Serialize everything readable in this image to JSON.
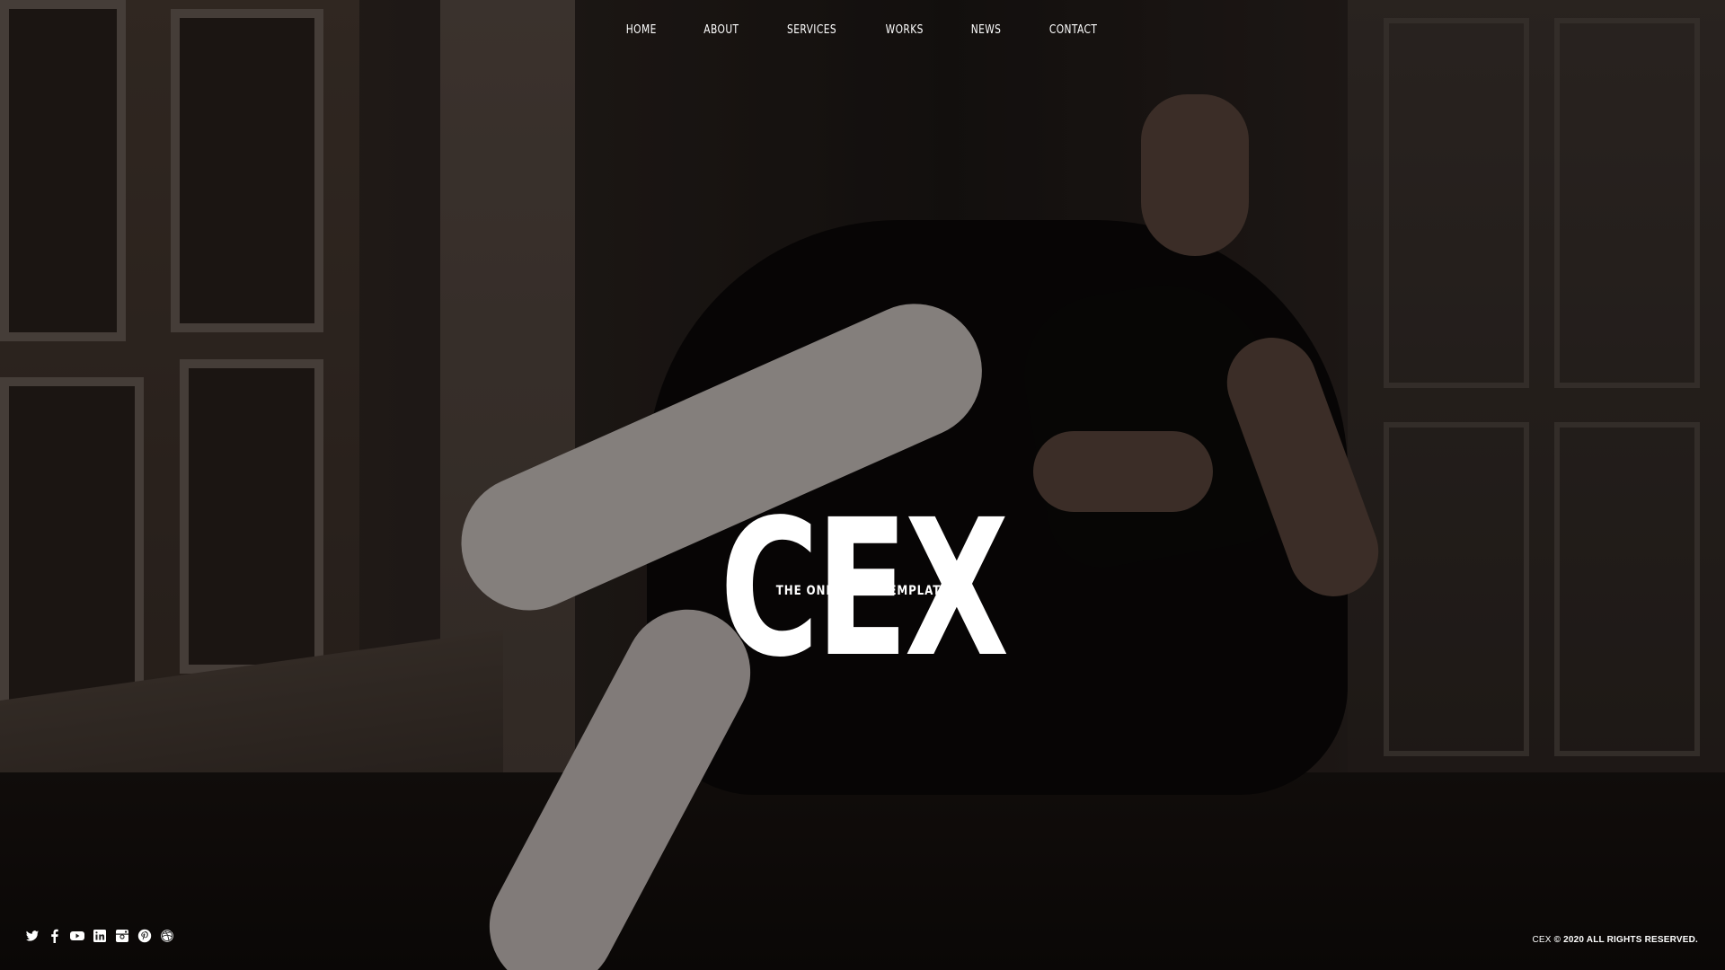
{
  "nav": {
    "items": [
      {
        "label": "HOME"
      },
      {
        "label": "ABOUT"
      },
      {
        "label": "SERVICES"
      },
      {
        "label": "WORKS"
      },
      {
        "label": "NEWS"
      },
      {
        "label": "CONTACT"
      }
    ]
  },
  "hero": {
    "title": "CEX",
    "subtitle": "THE ONE100TH TEMPLATE",
    "background_image": "woman-in-chair-photo"
  },
  "social": {
    "icons": [
      "twitter-icon",
      "facebook-icon",
      "youtube-icon",
      "linkedin-icon",
      "instagram-icon",
      "pinterest-icon",
      "dribbble-icon"
    ]
  },
  "footer": {
    "brand": "CEX",
    "copyright": "© 2020 ALL RIGHTS RESERVED."
  },
  "colors": {
    "text": "#ffffff",
    "overlay": "#000000"
  }
}
